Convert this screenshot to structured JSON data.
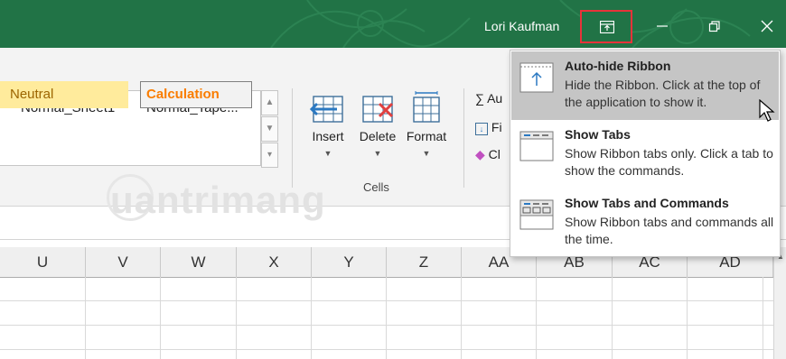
{
  "titlebar": {
    "user_name": "Lori Kaufman",
    "accent_color": "#217346",
    "highlight_color": "#e8333a",
    "ribbon_display_options_icon": "ribbon-display-options-icon",
    "minimize_icon": "minimize-icon",
    "restore_icon": "restore-icon",
    "close_icon": "close-icon"
  },
  "styles": {
    "normal_sheet1": "Normal_Sheet1",
    "normal_tape": "Normal_Tape...",
    "neutral": "Neutral",
    "calculation": "Calculation"
  },
  "cells_group": {
    "insert": "Insert",
    "delete": "Delete",
    "format": "Format",
    "label": "Cells"
  },
  "editing_group": {
    "autosum": "∑ Au",
    "fill": "Fi",
    "clear": "Cl"
  },
  "watermark": "uantrimang",
  "columns": [
    "U",
    "V",
    "W",
    "X",
    "Y",
    "Z",
    "AA",
    "AB",
    "AC",
    "AD"
  ],
  "ribbon_menu": {
    "items": [
      {
        "title": "Auto-hide Ribbon",
        "description": "Hide the Ribbon. Click at the top of the application to show it.",
        "icon": "auto-hide-ribbon-icon",
        "active": true
      },
      {
        "title": "Show Tabs",
        "description": "Show Ribbon tabs only. Click a tab to show the commands.",
        "icon": "show-tabs-icon",
        "active": false
      },
      {
        "title": "Show Tabs and Commands",
        "description": "Show Ribbon tabs and commands all the time.",
        "icon": "show-tabs-and-commands-icon",
        "active": false
      }
    ]
  }
}
